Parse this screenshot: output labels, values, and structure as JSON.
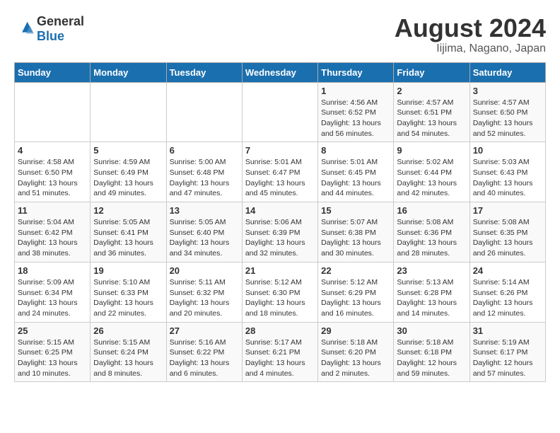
{
  "logo": {
    "general": "General",
    "blue": "Blue"
  },
  "title": "August 2024",
  "subtitle": "Iijima, Nagano, Japan",
  "days_of_week": [
    "Sunday",
    "Monday",
    "Tuesday",
    "Wednesday",
    "Thursday",
    "Friday",
    "Saturday"
  ],
  "weeks": [
    [
      {
        "day": "",
        "info": ""
      },
      {
        "day": "",
        "info": ""
      },
      {
        "day": "",
        "info": ""
      },
      {
        "day": "",
        "info": ""
      },
      {
        "day": "1",
        "info": "Sunrise: 4:56 AM\nSunset: 6:52 PM\nDaylight: 13 hours\nand 56 minutes."
      },
      {
        "day": "2",
        "info": "Sunrise: 4:57 AM\nSunset: 6:51 PM\nDaylight: 13 hours\nand 54 minutes."
      },
      {
        "day": "3",
        "info": "Sunrise: 4:57 AM\nSunset: 6:50 PM\nDaylight: 13 hours\nand 52 minutes."
      }
    ],
    [
      {
        "day": "4",
        "info": "Sunrise: 4:58 AM\nSunset: 6:50 PM\nDaylight: 13 hours\nand 51 minutes."
      },
      {
        "day": "5",
        "info": "Sunrise: 4:59 AM\nSunset: 6:49 PM\nDaylight: 13 hours\nand 49 minutes."
      },
      {
        "day": "6",
        "info": "Sunrise: 5:00 AM\nSunset: 6:48 PM\nDaylight: 13 hours\nand 47 minutes."
      },
      {
        "day": "7",
        "info": "Sunrise: 5:01 AM\nSunset: 6:47 PM\nDaylight: 13 hours\nand 45 minutes."
      },
      {
        "day": "8",
        "info": "Sunrise: 5:01 AM\nSunset: 6:45 PM\nDaylight: 13 hours\nand 44 minutes."
      },
      {
        "day": "9",
        "info": "Sunrise: 5:02 AM\nSunset: 6:44 PM\nDaylight: 13 hours\nand 42 minutes."
      },
      {
        "day": "10",
        "info": "Sunrise: 5:03 AM\nSunset: 6:43 PM\nDaylight: 13 hours\nand 40 minutes."
      }
    ],
    [
      {
        "day": "11",
        "info": "Sunrise: 5:04 AM\nSunset: 6:42 PM\nDaylight: 13 hours\nand 38 minutes."
      },
      {
        "day": "12",
        "info": "Sunrise: 5:05 AM\nSunset: 6:41 PM\nDaylight: 13 hours\nand 36 minutes."
      },
      {
        "day": "13",
        "info": "Sunrise: 5:05 AM\nSunset: 6:40 PM\nDaylight: 13 hours\nand 34 minutes."
      },
      {
        "day": "14",
        "info": "Sunrise: 5:06 AM\nSunset: 6:39 PM\nDaylight: 13 hours\nand 32 minutes."
      },
      {
        "day": "15",
        "info": "Sunrise: 5:07 AM\nSunset: 6:38 PM\nDaylight: 13 hours\nand 30 minutes."
      },
      {
        "day": "16",
        "info": "Sunrise: 5:08 AM\nSunset: 6:36 PM\nDaylight: 13 hours\nand 28 minutes."
      },
      {
        "day": "17",
        "info": "Sunrise: 5:08 AM\nSunset: 6:35 PM\nDaylight: 13 hours\nand 26 minutes."
      }
    ],
    [
      {
        "day": "18",
        "info": "Sunrise: 5:09 AM\nSunset: 6:34 PM\nDaylight: 13 hours\nand 24 minutes."
      },
      {
        "day": "19",
        "info": "Sunrise: 5:10 AM\nSunset: 6:33 PM\nDaylight: 13 hours\nand 22 minutes."
      },
      {
        "day": "20",
        "info": "Sunrise: 5:11 AM\nSunset: 6:32 PM\nDaylight: 13 hours\nand 20 minutes."
      },
      {
        "day": "21",
        "info": "Sunrise: 5:12 AM\nSunset: 6:30 PM\nDaylight: 13 hours\nand 18 minutes."
      },
      {
        "day": "22",
        "info": "Sunrise: 5:12 AM\nSunset: 6:29 PM\nDaylight: 13 hours\nand 16 minutes."
      },
      {
        "day": "23",
        "info": "Sunrise: 5:13 AM\nSunset: 6:28 PM\nDaylight: 13 hours\nand 14 minutes."
      },
      {
        "day": "24",
        "info": "Sunrise: 5:14 AM\nSunset: 6:26 PM\nDaylight: 13 hours\nand 12 minutes."
      }
    ],
    [
      {
        "day": "25",
        "info": "Sunrise: 5:15 AM\nSunset: 6:25 PM\nDaylight: 13 hours\nand 10 minutes."
      },
      {
        "day": "26",
        "info": "Sunrise: 5:15 AM\nSunset: 6:24 PM\nDaylight: 13 hours\nand 8 minutes."
      },
      {
        "day": "27",
        "info": "Sunrise: 5:16 AM\nSunset: 6:22 PM\nDaylight: 13 hours\nand 6 minutes."
      },
      {
        "day": "28",
        "info": "Sunrise: 5:17 AM\nSunset: 6:21 PM\nDaylight: 13 hours\nand 4 minutes."
      },
      {
        "day": "29",
        "info": "Sunrise: 5:18 AM\nSunset: 6:20 PM\nDaylight: 13 hours\nand 2 minutes."
      },
      {
        "day": "30",
        "info": "Sunrise: 5:18 AM\nSunset: 6:18 PM\nDaylight: 12 hours\nand 59 minutes."
      },
      {
        "day": "31",
        "info": "Sunrise: 5:19 AM\nSunset: 6:17 PM\nDaylight: 12 hours\nand 57 minutes."
      }
    ]
  ]
}
